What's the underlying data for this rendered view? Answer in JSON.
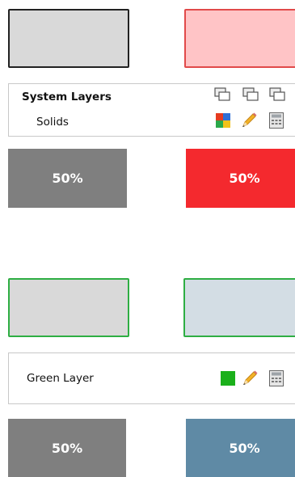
{
  "section1": {
    "swatch_left": {
      "fill": "#d9d9d9",
      "border": "#222222"
    },
    "swatch_right": {
      "fill": "#ffc4c6",
      "border": "#e14a4a"
    },
    "panel": {
      "title": "System Layers",
      "subtitle": "Solids"
    },
    "opacity_left": {
      "label": "50%",
      "color": "#7f7f7f"
    },
    "opacity_right": {
      "label": "50%",
      "color": "#f4292e"
    }
  },
  "section2": {
    "swatch_left": {
      "fill": "#d9d9d9",
      "border": "#2eae43"
    },
    "swatch_right": {
      "fill": "#d3dde4",
      "border": "#2eae43"
    },
    "panel": {
      "label": "Green Layer",
      "layer_color": "#1bb01b"
    },
    "opacity_left": {
      "label": "50%",
      "color": "#7f7f7f"
    },
    "opacity_right": {
      "label": "50%",
      "color": "#5f8aa5"
    }
  },
  "icons": {
    "layer_stack": "layer-stack-icon",
    "color_grid": "color-grid-icon",
    "pencil": "pencil-icon",
    "calculator": "calculator-icon"
  }
}
